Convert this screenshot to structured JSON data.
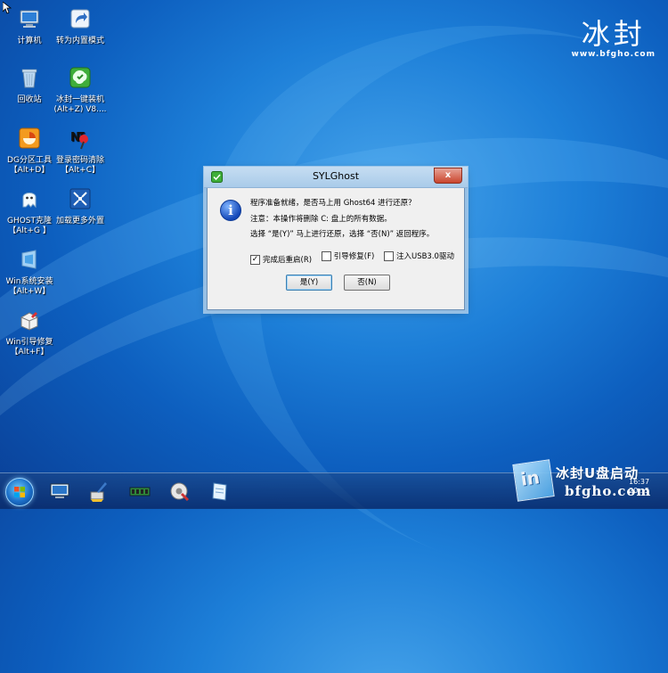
{
  "desktop_icons": [
    {
      "label_line1": "计算机",
      "label_line2": "",
      "icon": "computer-icon"
    },
    {
      "label_line1": "转为内置模式",
      "label_line2": "",
      "icon": "shortcut-arrow-icon"
    },
    {
      "label_line1": "回收站",
      "label_line2": "",
      "icon": "recycle-bin-icon"
    },
    {
      "label_line1": "冰封一键装机",
      "label_line2": "(Alt+Z) V8....",
      "icon": "installer-icon"
    },
    {
      "label_line1": "DG分区工具",
      "label_line2": "【Alt+D】",
      "icon": "partition-tool-icon"
    },
    {
      "label_line1": "登录密码清除",
      "label_line2": "【Alt+C】",
      "icon": "password-clear-icon"
    },
    {
      "label_line1": "GHOST克隆",
      "label_line2": "【Alt+G 】",
      "icon": "ghost-icon"
    },
    {
      "label_line1": "加载更多外置",
      "label_line2": "",
      "icon": "load-more-icon"
    },
    {
      "label_line1": "Win系统安装",
      "label_line2": "【Alt+W】",
      "icon": "win-install-icon"
    },
    {
      "label_line1": "Win引导修复",
      "label_line2": "【Alt+F】",
      "icon": "boot-repair-icon"
    }
  ],
  "logo": {
    "title": "冰封",
    "url": "www.bfgho.com"
  },
  "dialog": {
    "title": "SYLGhost",
    "close": "x",
    "line1": "程序准备就绪，是否马上用 Ghost64 进行还原？",
    "line2": "注意：本操作将删除 C: 盘上的所有数据。",
    "line3": "选择 “是(Y)” 马上进行还原，选择 “否(N)” 返回程序。",
    "options": [
      {
        "label": "完成后重启(R)",
        "checked": true
      },
      {
        "label": "引导修复(F)",
        "checked": false
      },
      {
        "label": "注入USB3.0驱动",
        "checked": false
      }
    ],
    "yes_label": "是(Y)",
    "no_label": "否(N)"
  },
  "taskbar": {
    "apps": [
      "monitor-icon",
      "cleanup-brush-icon",
      "ram-chip-icon",
      "settings-tools-icon",
      "notepad-icon"
    ],
    "clock_time": "16:37",
    "clock_date": "20...5"
  },
  "watermark": {
    "line1": "冰封U盘启动",
    "line2": "bfgho.com",
    "cube": "in"
  }
}
